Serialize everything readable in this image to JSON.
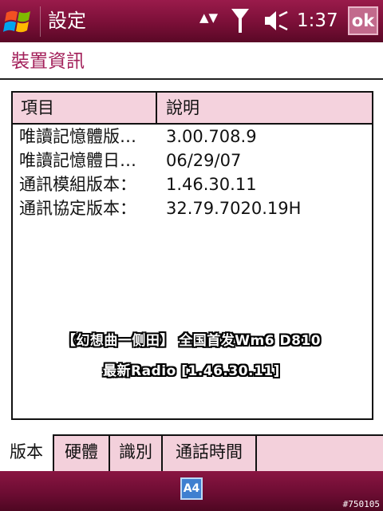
{
  "titlebar": {
    "app_title": "設定",
    "sync_glyph": "▲▼",
    "clock": "1:37",
    "ok_label": "ok",
    "icons": [
      "windows-start-icon",
      "sync-arrows-icon",
      "signal-antenna-icon",
      "volume-icon"
    ]
  },
  "page": {
    "title": "裝置資訊"
  },
  "list": {
    "headers": [
      "項目",
      "說明"
    ],
    "rows": [
      [
        "唯讀記憶體版…",
        "3.00.708.9"
      ],
      [
        "唯讀記憶體日…",
        "06/29/07"
      ],
      [
        "通訊模組版本：",
        "1.46.30.11"
      ],
      [
        "通訊協定版本：",
        "32.79.7020.19H"
      ]
    ]
  },
  "caption": {
    "line1": "【幻想曲一侧田】 全国首发Wm6 D810",
    "line2": "最新Radio [1.46.30.11]"
  },
  "tabs": [
    "版本",
    "硬體",
    "識別",
    "通話時間"
  ],
  "menubar": {
    "sip_label": "A4"
  },
  "watermark": "#750105",
  "colors": {
    "accent": "#9a1b4b",
    "heading": "#a3205a",
    "header_bg": "#f4d2dd"
  }
}
